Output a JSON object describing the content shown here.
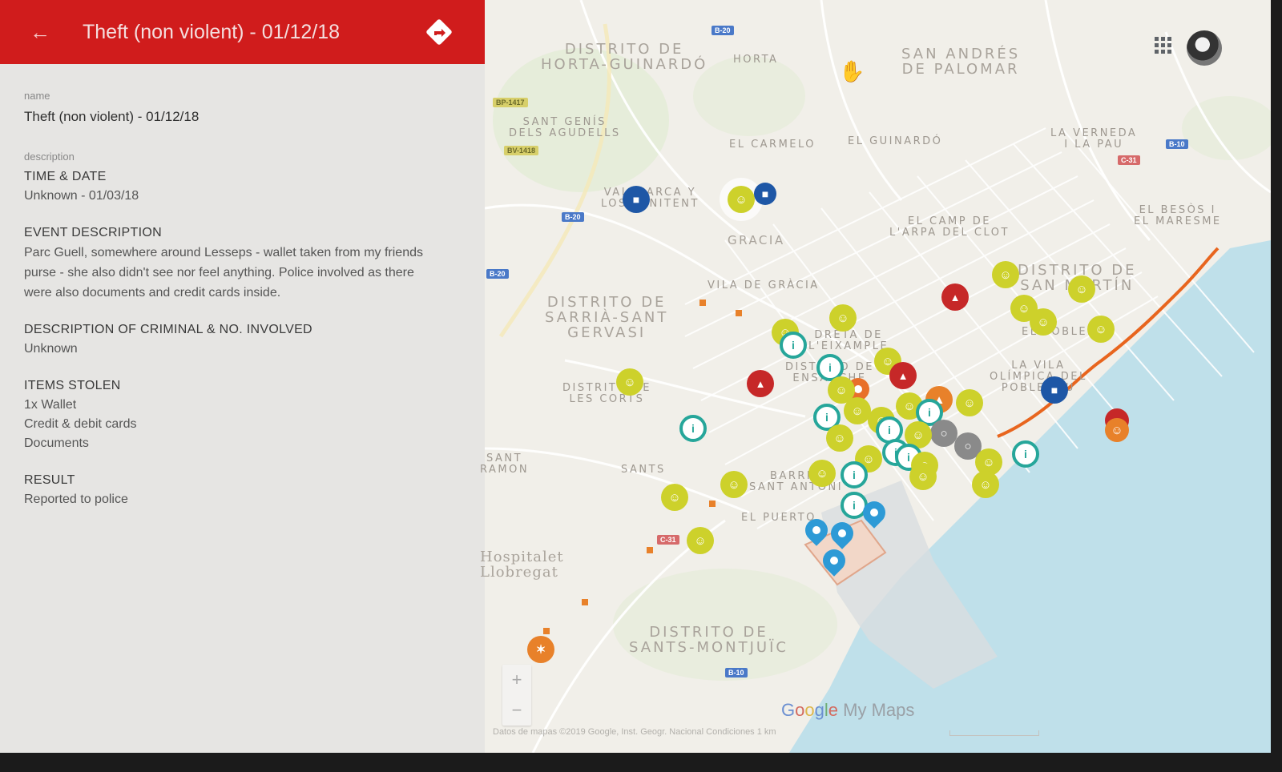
{
  "panel": {
    "title": "Theft (non violent) - 01/12/18",
    "back_icon": "arrow-back-icon",
    "directions_icon": "directions-icon",
    "name_label": "name",
    "name_value": "Theft (non violent) - 01/12/18",
    "description_label": "description",
    "sections": [
      {
        "heading": "TIME & DATE",
        "lines": [
          "Unknown - 01/03/18"
        ]
      },
      {
        "heading": "EVENT DESCRIPTION",
        "lines": [
          "Parc Guell, somewhere around Lesseps - wallet taken from my friends purse - she also didn't see nor feel anything. Police involved as there were also documents and credit cards inside."
        ]
      },
      {
        "heading": "DESCRIPTION OF CRIMINAL & NO. INVOLVED",
        "lines": [
          "Unknown"
        ]
      },
      {
        "heading": "ITEMS STOLEN",
        "lines": [
          "1x Wallet",
          "Credit & debit cards",
          "Documents"
        ]
      },
      {
        "heading": "RESULT",
        "lines": [
          "Reported to police"
        ]
      }
    ]
  },
  "map": {
    "districts": {
      "horta": "DISTRITO DE\nHORTA-GUINARDÓ",
      "horta_small": "HORTA",
      "san_andres": "SAN ANDRÉS\nDE PALOMAR",
      "sant_genis": "SANT GENÍS\nDELS AGUDELLS",
      "el_carmelo": "EL CARMELO",
      "el_guinardo": "EL GUINARDÓ",
      "la_verneda": "LA VERNEDA\nI LA PAU",
      "vallcarca": "VALLCARCA Y\nLOS PENITENT",
      "gracia": "GRACIA",
      "camp_arpa": "EL CAMP DE\nL'ARPA DEL CLOT",
      "besos": "EL BESÒS I\nEL MARESME",
      "sant_marti": "DISTRITO DE\nSAN MARTÍN",
      "vila_gracia": "VILA DE GRÀCIA",
      "sarria": "DISTRITO DE\nSARRIÀ-SANT\nGERVASI",
      "eixample": "DRETA DE\nL'EIXAMPLE",
      "distrito_ensanche": "DISTRITO DE\nENSANCHE",
      "les_corts": "DISTRITO DE\nLES CORTS",
      "vila_olimpica": "LA VILA\nOLÍMPICA DEL\nPOBLENOU",
      "el_poble": "EL POBLENOU",
      "sants": "SANTS",
      "sant_ramon": "SANT\nRAMON",
      "barrio_sant_antoni": "BARRIO\nSANT ANTONI",
      "el_puerto": "EL PUERTO",
      "hospitalet": "Hospitalet\nLlobregat",
      "sants_montjuic": "DISTRITO DE\nSANTS-MONTJUÏC"
    },
    "road_labels": [
      "B-20",
      "BP-1417",
      "BV-1418",
      "B-20",
      "B-20",
      "C-31",
      "B-10",
      "B-10",
      "C-31"
    ],
    "zoom_in": "+",
    "zoom_out": "−",
    "apps_icon": "apps-grid-icon",
    "avatar_icon": "user-avatar",
    "cursor_icon": "hand-cursor-icon",
    "logo_text": [
      "G",
      "o",
      "o",
      "g",
      "l",
      "e"
    ],
    "logo_suffix": " My Maps",
    "attribution": "Datos de mapas ©2019 Google, Inst. Geogr. Nacional    Condiciones    1 km",
    "colors": {
      "header": "#d01c1c",
      "pedestrian": "#cdd12b",
      "info": "#26a69a",
      "car": "#1e57a6",
      "warning": "#c62828",
      "coast_road": "#e8651e"
    }
  }
}
